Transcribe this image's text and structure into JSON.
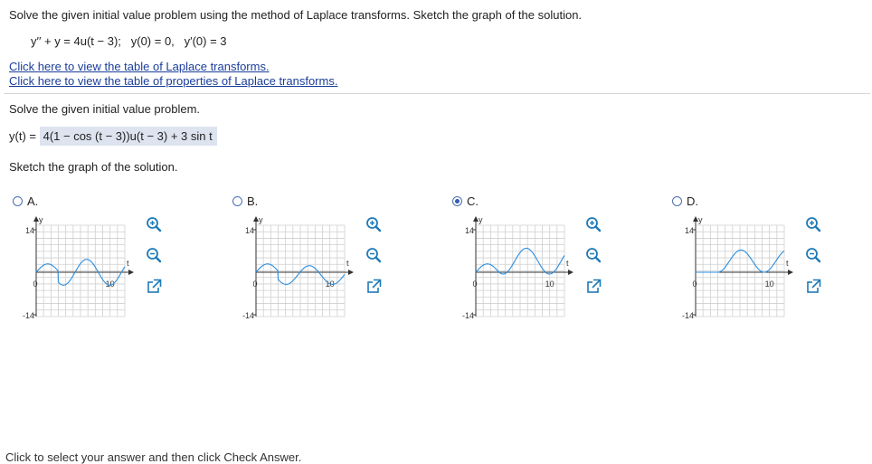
{
  "problem": {
    "instruction": "Solve the given initial value problem using the method of Laplace transforms. Sketch the graph of the solution.",
    "ode": "y′′ + y = 4u(t − 3);",
    "ic1": "y(0) = 0,",
    "ic2": "y′(0) = 3"
  },
  "links": {
    "table_transforms": "Click here to view the table of Laplace transforms.",
    "table_properties": "Click here to view the table of properties of Laplace transforms."
  },
  "part1": {
    "prompt": "Solve the given initial value problem.",
    "answer_prefix": "y(t) = ",
    "answer_value": "4(1 −  cos (t − 3))u(t − 3) + 3 sin t"
  },
  "part2": {
    "prompt": "Sketch the graph of the solution."
  },
  "options": [
    {
      "letter": "A.",
      "selected": false
    },
    {
      "letter": "B.",
      "selected": false
    },
    {
      "letter": "C.",
      "selected": true
    },
    {
      "letter": "D.",
      "selected": false
    }
  ],
  "graph_labels": {
    "y_axis": "y",
    "x_axis": "t",
    "y_max": "14",
    "y_min": "-14",
    "origin": "0",
    "x_tick": "10"
  },
  "tools": {
    "zoom_in": "zoom-in-icon",
    "zoom_out": "zoom-out-icon",
    "popout": "external-window-icon"
  },
  "colors": {
    "curve": "#2a8ee0",
    "grid": "#cfcfcf",
    "link": "#1a3d9a",
    "answer_bg": "#dde3ef",
    "radio": "#2b5fb3"
  },
  "footer": {
    "hint": "Click to select your answer and then click Check Answer."
  }
}
